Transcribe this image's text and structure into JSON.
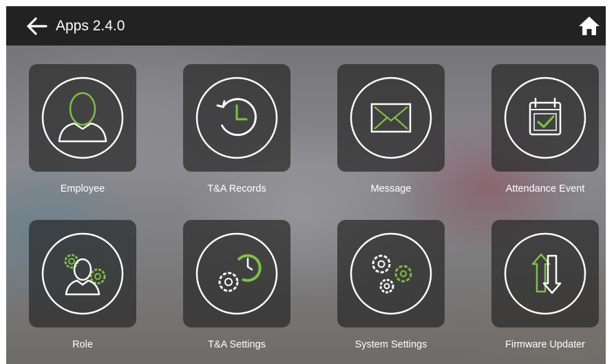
{
  "header": {
    "title": "Apps 2.4.0",
    "back_icon": "arrow-left-icon",
    "home_icon": "home-icon"
  },
  "colors": {
    "accent_green": "#7dc242",
    "topbar": "#222222",
    "tile_bg": "#2a2a2a",
    "icon_stroke": "#ffffff"
  },
  "apps": [
    {
      "label": "Employee",
      "icon": "employee-icon"
    },
    {
      "label": "T&A Records",
      "icon": "records-history-icon"
    },
    {
      "label": "Message",
      "icon": "message-envelope-icon"
    },
    {
      "label": "Attendance Event",
      "icon": "calendar-check-icon"
    },
    {
      "label": "Role",
      "icon": "role-gears-icon"
    },
    {
      "label": "T&A Settings",
      "icon": "ta-settings-icon"
    },
    {
      "label": "System Settings",
      "icon": "system-settings-icon"
    },
    {
      "label": "Firmware Updater",
      "icon": "firmware-update-icon"
    }
  ]
}
